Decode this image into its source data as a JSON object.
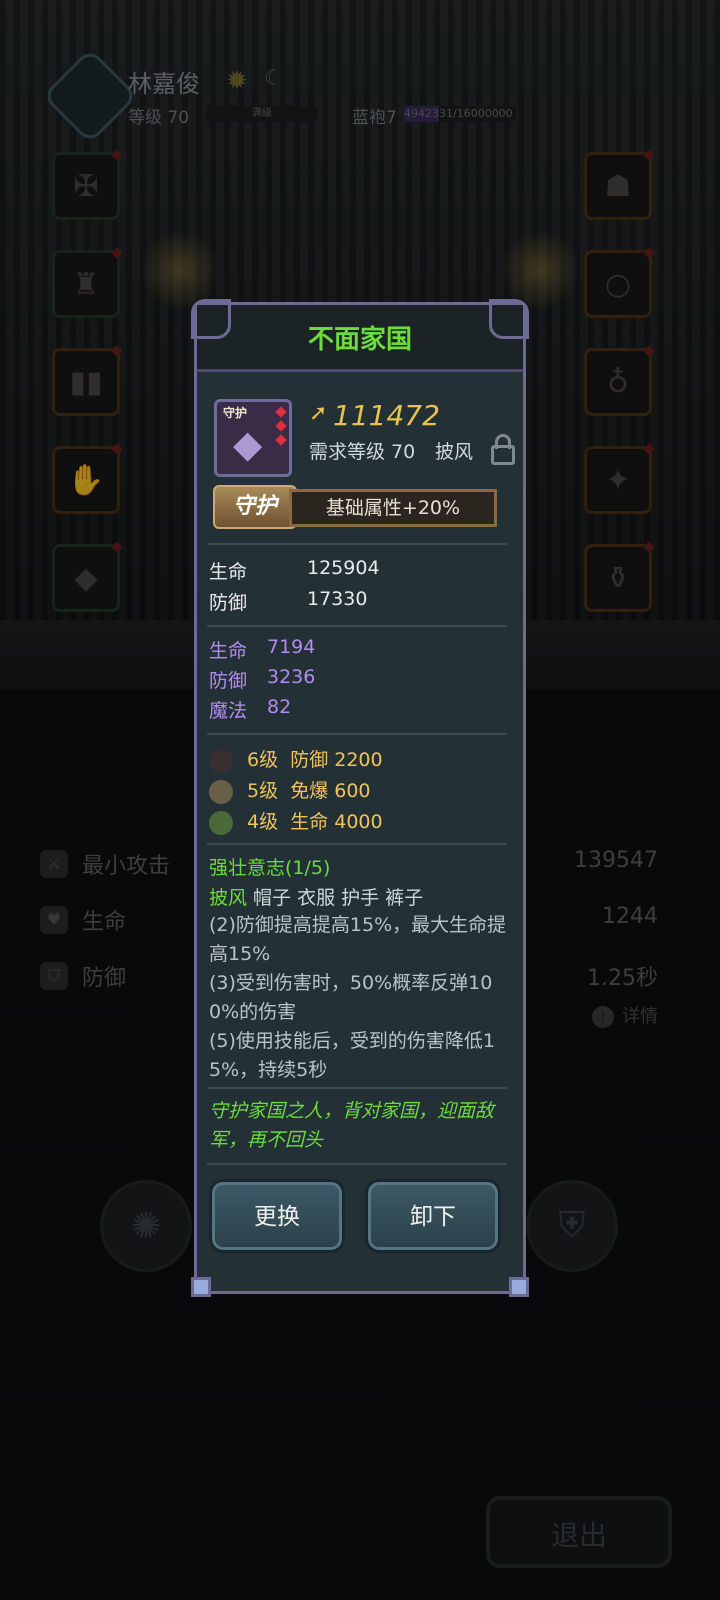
{
  "player": {
    "name": "林嘉俊",
    "level_label": "等级 70",
    "level_bar_text": "满级",
    "rank": "蓝袍7",
    "exp_text": "4942331/16000000",
    "exp_progress": 0.309
  },
  "stats": [
    {
      "label": "最小攻击",
      "value": "139547"
    },
    {
      "label": "生命",
      "value": "1244"
    },
    {
      "label": "防御",
      "value": "1.25秒"
    }
  ],
  "details_label": "详情",
  "exit_label": "退出",
  "popup": {
    "title": "不面家国",
    "power": "111472",
    "requirement": "需求等级 70",
    "slot": "披风",
    "icon_tag": "守护",
    "guard_badge": "守护",
    "guard_bonus": "基础属性+20%",
    "base_stats": [
      {
        "label": "生命",
        "value": "125904"
      },
      {
        "label": "防御",
        "value": "17330"
      }
    ],
    "extra_stats": [
      {
        "label": "生命",
        "value": "7194"
      },
      {
        "label": "防御",
        "value": "3236"
      },
      {
        "label": "魔法",
        "value": "82"
      }
    ],
    "gems": [
      {
        "level": "6级",
        "stat": "防御 2200"
      },
      {
        "level": "5级",
        "stat": "免爆 600"
      },
      {
        "level": "4级",
        "stat": "生命 4000"
      }
    ],
    "set_name": "强壮意志(1/5)",
    "set_parts_active": "披风",
    "set_parts_rest": " 帽子 衣服 护手 裤子",
    "set_effects": [
      "(2)防御提高提高15%，最大生命提高15%",
      "(3)受到伤害时，50%概率反弹100%的伤害",
      "(5)使用技能后，受到的伤害降低15%，持续5秒"
    ],
    "flavor": "守护家国之人，背对家国，迎面敌军，再不回头",
    "replace_label": "更换",
    "unequip_label": "卸下"
  },
  "colors": {
    "title_green": "#6bdc3b",
    "power_gold": "#e8c24a",
    "extra_purple": "#b48cf0",
    "gem_gold": "#f0c45a",
    "popup_bg": "#233036"
  }
}
